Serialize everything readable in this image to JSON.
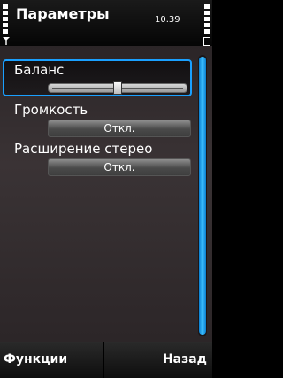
{
  "statusbar": {
    "title": "Параметры",
    "time": "10.39",
    "icons": {
      "signal": "signal-strength-icon",
      "antenna": "antenna-icon",
      "battery": "battery-level-icon"
    }
  },
  "settings": {
    "balance": {
      "label": "Баланс",
      "slider_position": 0.5
    },
    "volume": {
      "label": "Громкость",
      "value": "Откл."
    },
    "stereo": {
      "label": "Расширение стерео",
      "value": "Откл."
    }
  },
  "softkeys": {
    "left": "Функции",
    "right": "Назад"
  },
  "colors": {
    "accent": "#1aa0ff",
    "background": "#2b2527"
  }
}
